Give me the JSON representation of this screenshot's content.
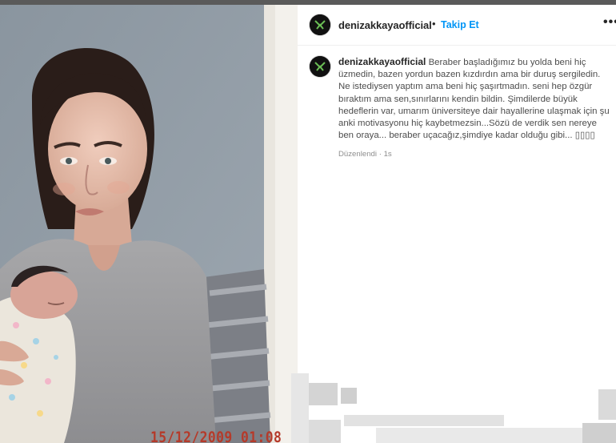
{
  "post": {
    "username": "denizakkayaofficial",
    "separator": "•",
    "follow_label": "Takip Et",
    "more_label": "•••",
    "caption_text": "Beraber başladığımız bu yolda beni hiç üzmedin, bazen yordun bazen kızdırdın ama bir duruş sergiledin. Ne istediysen yaptım ama beni hiç şaşırtmadın. seni hep özgür bıraktım ama sen,sınırlarını kendin bildin. Şimdilerde büyük hedeflerin var, umarım üniversiteye dair hayallerine ulaşmak için şu anki motivasyonu hiç kaybetmezsin...Sözü de verdik sen nereye ben oraya... beraber uçacağız,şimdiye kadar olduğu gibi... ▯▯▯▯",
    "edited_label": "Düzenlendi",
    "meta_separator": "·",
    "time_ago": "1s"
  },
  "photo": {
    "date_stamp": "15/12/2009 01:08"
  },
  "colors": {
    "follow_blue": "#0095f6",
    "username_text": "#262626",
    "caption_text": "#4d4d4d",
    "meta_text": "#8e8e8e",
    "stamp_red": "#b53a2a"
  }
}
